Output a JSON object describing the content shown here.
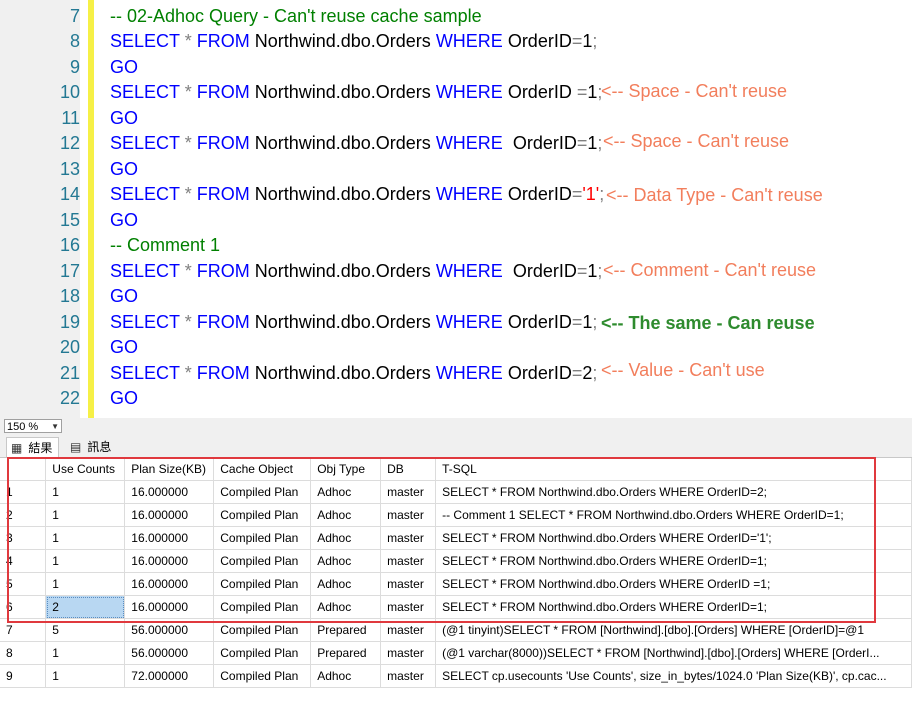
{
  "editor": {
    "lines": [
      {
        "n": "7",
        "parts": [
          [
            "cm",
            "-- 02-Adhoc Query - Can't reuse cache sample"
          ]
        ]
      },
      {
        "n": "8",
        "parts": [
          [
            "kw",
            "SELECT "
          ],
          [
            "op",
            "* "
          ],
          [
            "kw",
            "FROM "
          ],
          [
            "tx",
            "Northwind.dbo.Orders "
          ],
          [
            "kw",
            "WHERE "
          ],
          [
            "tx",
            "OrderID"
          ],
          [
            "op",
            "="
          ],
          [
            "tx",
            "1"
          ],
          [
            "op",
            ";"
          ]
        ]
      },
      {
        "n": "9",
        "parts": [
          [
            "kw",
            "GO"
          ]
        ]
      },
      {
        "n": "10",
        "parts": [
          [
            "kw",
            "SELECT "
          ],
          [
            "op",
            "* "
          ],
          [
            "kw",
            "FROM "
          ],
          [
            "tx",
            "Northwind.dbo.Orders "
          ],
          [
            "kw",
            "WHERE "
          ],
          [
            "tx",
            "OrderID "
          ],
          [
            "op",
            "="
          ],
          [
            "tx",
            "1"
          ],
          [
            "op",
            ";"
          ]
        ]
      },
      {
        "n": "11",
        "parts": [
          [
            "kw",
            "GO"
          ]
        ]
      },
      {
        "n": "12",
        "parts": [
          [
            "kw",
            "SELECT "
          ],
          [
            "op",
            "* "
          ],
          [
            "kw",
            "FROM "
          ],
          [
            "tx",
            "Northwind.dbo.Orders "
          ],
          [
            "kw",
            "WHERE  "
          ],
          [
            "tx",
            "OrderID"
          ],
          [
            "op",
            "="
          ],
          [
            "tx",
            "1"
          ],
          [
            "op",
            ";"
          ]
        ]
      },
      {
        "n": "13",
        "parts": [
          [
            "kw",
            "GO"
          ]
        ]
      },
      {
        "n": "14",
        "parts": [
          [
            "kw",
            "SELECT "
          ],
          [
            "op",
            "* "
          ],
          [
            "kw",
            "FROM "
          ],
          [
            "tx",
            "Northwind.dbo.Orders "
          ],
          [
            "kw",
            "WHERE "
          ],
          [
            "tx",
            "OrderID"
          ],
          [
            "op",
            "="
          ],
          [
            "str",
            "'1'"
          ],
          [
            "op",
            ";"
          ]
        ]
      },
      {
        "n": "15",
        "parts": [
          [
            "kw",
            "GO"
          ]
        ]
      },
      {
        "n": "16",
        "parts": [
          [
            "cm",
            "-- Comment 1"
          ]
        ]
      },
      {
        "n": "17",
        "parts": [
          [
            "kw",
            "SELECT "
          ],
          [
            "op",
            "* "
          ],
          [
            "kw",
            "FROM "
          ],
          [
            "tx",
            "Northwind.dbo.Orders "
          ],
          [
            "kw",
            "WHERE  "
          ],
          [
            "tx",
            "OrderID"
          ],
          [
            "op",
            "="
          ],
          [
            "tx",
            "1"
          ],
          [
            "op",
            ";"
          ]
        ]
      },
      {
        "n": "18",
        "parts": [
          [
            "kw",
            "GO"
          ]
        ]
      },
      {
        "n": "19",
        "parts": [
          [
            "kw",
            "SELECT "
          ],
          [
            "op",
            "* "
          ],
          [
            "kw",
            "FROM "
          ],
          [
            "tx",
            "Northwind.dbo.Orders "
          ],
          [
            "kw",
            "WHERE "
          ],
          [
            "tx",
            "OrderID"
          ],
          [
            "op",
            "="
          ],
          [
            "tx",
            "1"
          ],
          [
            "op",
            ";"
          ]
        ]
      },
      {
        "n": "20",
        "parts": [
          [
            "kw",
            "GO"
          ]
        ]
      },
      {
        "n": "21",
        "parts": [
          [
            "kw",
            "SELECT "
          ],
          [
            "op",
            "* "
          ],
          [
            "kw",
            "FROM "
          ],
          [
            "tx",
            "Northwind.dbo.Orders "
          ],
          [
            "kw",
            "WHERE "
          ],
          [
            "tx",
            "OrderID"
          ],
          [
            "op",
            "="
          ],
          [
            "tx",
            "2"
          ],
          [
            "op",
            ";"
          ]
        ]
      },
      {
        "n": "22",
        "parts": [
          [
            "kw",
            "GO"
          ]
        ]
      }
    ],
    "notes": {
      "line10": "<-- Space - Can't reuse",
      "line12": "<-- Space - Can't reuse",
      "line14": "<-- Data Type - Can't reuse",
      "line17": "<-- Comment - Can't reuse",
      "line19": "<-- The same - Can reuse",
      "line21": "<-- Value - Can't use"
    }
  },
  "zoom": {
    "value": "150 %"
  },
  "tabs": {
    "results": "結果",
    "messages": "訊息"
  },
  "grid": {
    "headers": [
      "Use Counts",
      "Plan Size(KB)",
      "Cache Object",
      "Obj Type",
      "DB",
      "T-SQL"
    ],
    "rows": [
      {
        "n": "1",
        "uc": "1",
        "size": "16.000000",
        "co": "Compiled Plan",
        "ot": "Adhoc",
        "db": "master",
        "sql": "SELECT * FROM Northwind.dbo.Orders WHERE OrderID=2;"
      },
      {
        "n": "2",
        "uc": "1",
        "size": "16.000000",
        "co": "Compiled Plan",
        "ot": "Adhoc",
        "db": "master",
        "sql": "-- Comment 1  SELECT * FROM Northwind.dbo.Orders WHERE  OrderID=1;"
      },
      {
        "n": "3",
        "uc": "1",
        "size": "16.000000",
        "co": "Compiled Plan",
        "ot": "Adhoc",
        "db": "master",
        "sql": "SELECT * FROM Northwind.dbo.Orders WHERE OrderID='1';"
      },
      {
        "n": "4",
        "uc": "1",
        "size": "16.000000",
        "co": "Compiled Plan",
        "ot": "Adhoc",
        "db": "master",
        "sql": "SELECT * FROM Northwind.dbo.Orders WHERE  OrderID=1;"
      },
      {
        "n": "5",
        "uc": "1",
        "size": "16.000000",
        "co": "Compiled Plan",
        "ot": "Adhoc",
        "db": "master",
        "sql": "SELECT * FROM Northwind.dbo.Orders WHERE OrderID =1;"
      },
      {
        "n": "6",
        "uc": "2",
        "size": "16.000000",
        "co": "Compiled Plan",
        "ot": "Adhoc",
        "db": "master",
        "sql": "SELECT * FROM Northwind.dbo.Orders WHERE OrderID=1;"
      },
      {
        "n": "7",
        "uc": "5",
        "size": "56.000000",
        "co": "Compiled Plan",
        "ot": "Prepared",
        "db": "master",
        "sql": "(@1 tinyint)SELECT * FROM [Northwind].[dbo].[Orders] WHERE [OrderID]=@1"
      },
      {
        "n": "8",
        "uc": "1",
        "size": "56.000000",
        "co": "Compiled Plan",
        "ot": "Prepared",
        "db": "master",
        "sql": "(@1 varchar(8000))SELECT * FROM [Northwind].[dbo].[Orders] WHERE [OrderI..."
      },
      {
        "n": "9",
        "uc": "1",
        "size": "72.000000",
        "co": "Compiled Plan",
        "ot": "Adhoc",
        "db": "master",
        "sql": "SELECT  cp.usecounts 'Use Counts', size_in_bytes/1024.0 'Plan Size(KB)', cp.cac..."
      }
    ]
  },
  "colors": {
    "keyword": "#0000ff",
    "comment": "#008000",
    "string": "#ff0000",
    "note": "#f27e5c",
    "note_good": "#2e8b2e",
    "highlight": "#e0393e",
    "selected": "#b8d7f2"
  }
}
